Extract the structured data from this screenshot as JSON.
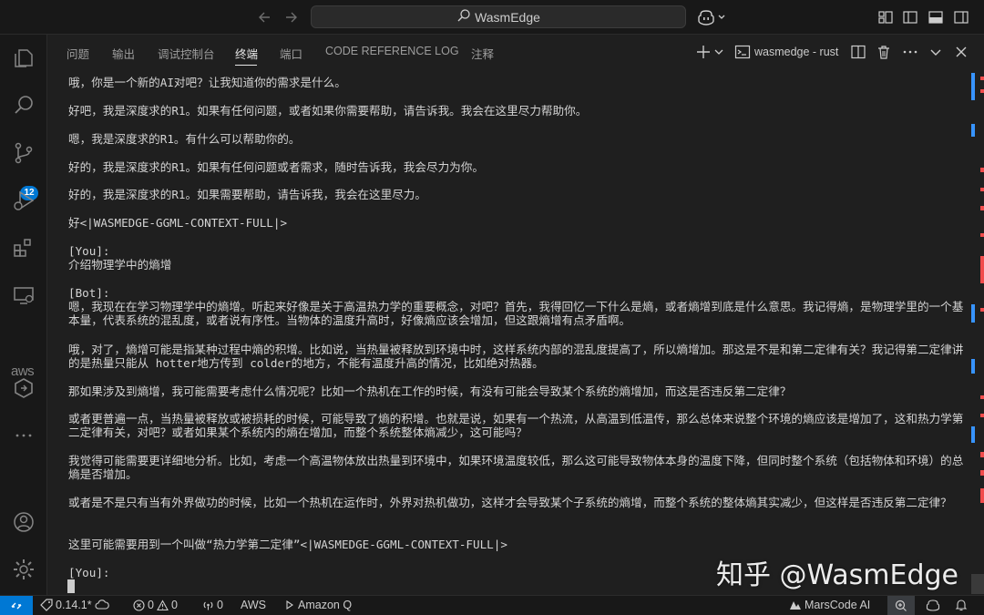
{
  "titlebar": {
    "search_text": "WasmEdge",
    "back_icon": "arrow-left-icon",
    "forward_icon": "arrow-right-icon"
  },
  "activitybar": {
    "source_control_badge": "12",
    "aws_label": "aws"
  },
  "panel": {
    "tabs": [
      {
        "label": "问题",
        "active": false
      },
      {
        "label": "输出",
        "active": false
      },
      {
        "label": "调试控制台",
        "active": false
      },
      {
        "label": "终端",
        "active": true
      },
      {
        "label": "端口",
        "active": false
      },
      {
        "label": "CODE REFERENCE LOG",
        "active": false
      },
      {
        "label": "注释",
        "active": false
      }
    ],
    "terminal_name": "wasmedge - rust"
  },
  "terminal": {
    "lines": [
      "哦，你是一个新的AI对吧？让我知道你的需求是什么。",
      "好吧，我是深度求的R1。如果有任何问题，或者如果你需要帮助，请告诉我。我会在这里尽力帮助你。",
      "嗯，我是深度求的R1。有什么可以帮助你的。",
      "好的，我是深度求的R1。如果有任何问题或者需求，随时告诉我，我会尽力为你。",
      "好的，我是深度求的R1。如果需要帮助，请告诉我，我会在这里尽力。",
      "好<|WASMEDGE-GGML-CONTEXT-FULL|>",
      "[You]:\n介绍物理学中的熵增",
      "[Bot]:\n嗯，我现在在学习物理学中的熵增。听起来好像是关于高温热力学的重要概念，对吧？首先，我得回忆一下什么是熵，或者熵增到底是什么意思。我记得熵，是物理学里的一个基本量，代表系统的混乱度，或者说有序性。当物体的温度升高时，好像熵应该会增加，但这跟熵增有点矛盾啊。",
      "哦，对了，熵增可能是指某种过程中熵的积增。比如说，当热量被释放到环境中时，这样系统内部的混乱度提高了，所以熵增加。那这是不是和第二定律有关？我记得第二定律讲的是热量只能从 hotter地方传到 colder的地方，不能有温度升高的情况，比如绝对热器。",
      "那如果涉及到熵增，我可能需要考虑什么情况呢？比如一个热机在工作的时候，有没有可能会导致某个系统的熵增加，而这是否违反第二定律？",
      "或者更普遍一点，当热量被释放或被损耗的时候，可能导致了熵的积增。也就是说，如果有一个热流，从高温到低温传，那么总体来说整个环境的熵应该是增加了，这和热力学第二定律有关，对吧？或者如果某个系统内的熵在增加，而整个系统整体熵减少，这可能吗？",
      "我觉得可能需要更详细地分析。比如，考虑一个高温物体放出热量到环境中，如果环境温度较低，那么这可能导致物体本身的温度下降，但同时整个系统（包括物体和环境）的总熵是否增加。",
      "或者是不是只有当有外界做功的时候，比如一个热机在运作时，外界对热机做功，这样才会导致某个子系统的熵增，而整个系统的整体熵其实减少，但这样是否违反第二定律？",
      "这里可能需要用到一个叫做“热力学第二定律”<|WASMEDGE-GGML-CONTEXT-FULL|>",
      "[You]:"
    ]
  },
  "watermark": "知乎 @WasmEdge",
  "statusbar": {
    "version": "0.14.1*",
    "errors": "0",
    "warnings": "0",
    "ports": "0",
    "aws": "AWS",
    "amazonq": "Amazon Q",
    "marscode": "MarsCode AI"
  },
  "colors": {
    "accent": "#0078d4",
    "ruler_red": "#f14c4c",
    "ruler_blue": "#3794ff"
  }
}
